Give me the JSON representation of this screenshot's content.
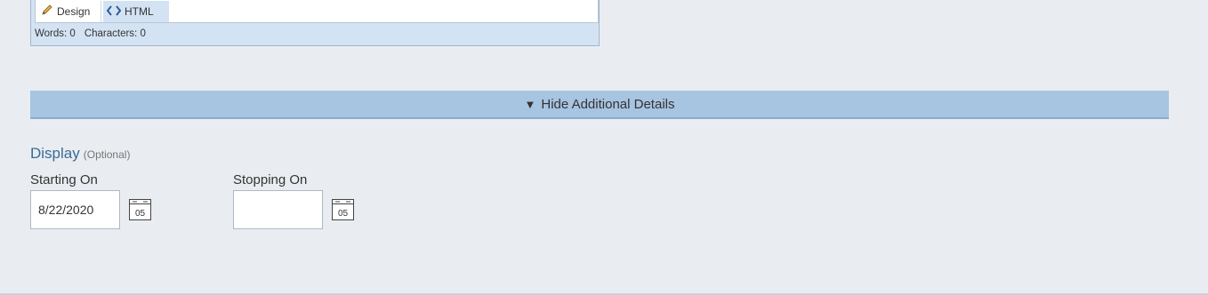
{
  "editor": {
    "modes": {
      "design_label": "Design",
      "html_label": "HTML"
    },
    "status": {
      "words": "Words: 0",
      "characters": "Characters: 0"
    }
  },
  "details_toggle": {
    "arrow": "▼",
    "label": "Hide Additional Details"
  },
  "display": {
    "title": "Display",
    "optional": "(Optional)",
    "starting": {
      "label": "Starting On",
      "value": "8/22/2020"
    },
    "stopping": {
      "label": "Stopping On",
      "value": ""
    },
    "calendar_day": "05"
  },
  "colors": {
    "accent_title": "#3b6a95",
    "toggle_bar": "#a7c4e1",
    "page_bg": "#e9edf1"
  },
  "icons": {
    "design": "pencil-icon",
    "html": "code-icon",
    "calendar": "calendar-icon"
  }
}
